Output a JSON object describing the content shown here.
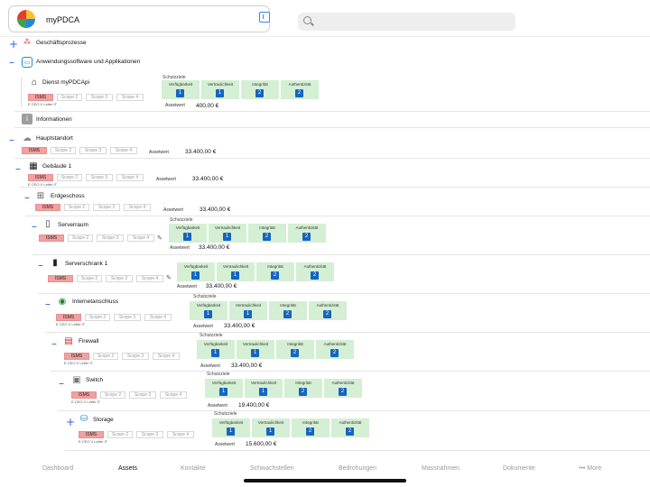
{
  "app": {
    "title": "myPDCA"
  },
  "search": {
    "placeholder": ""
  },
  "labels": {
    "schutzziele": "Schutzziele",
    "verfuegbarkeit": "Verfügbarkeit",
    "vertraulichkeit": "Vertraulichkeit",
    "integritaet": "Integrität",
    "authentizitaet": "Authentizität",
    "assetwert": "Assetwert"
  },
  "top_items": [
    {
      "name": "Geschäftsprozesse"
    },
    {
      "name": "Anwendungssoftware und Applikationen"
    },
    {
      "name": "Informationen"
    }
  ],
  "assets": [
    {
      "name": "Dienst myPDCApi",
      "tags": [
        "ISMS",
        "Scope 2",
        "Scope 3",
        "Scope 4"
      ],
      "owner": "E CEO V Leiter IT",
      "schutzziele": [
        1,
        1,
        2,
        2
      ],
      "assetwert": "400,00 €"
    },
    {
      "name": "Hauptstandort",
      "tags": [
        "ISMS",
        "Scope 2",
        "Scope 3",
        "Scope 4"
      ],
      "owner": "",
      "schutzziele": null,
      "assetwert": "33.400,00 €"
    },
    {
      "name": "Gebäude 1",
      "tags": [
        "ISMS",
        "Scope 2",
        "Scope 3",
        "Scope 4"
      ],
      "owner": "E CEO V Leiter IT",
      "schutzziele": null,
      "assetwert": "33.400,00 €"
    },
    {
      "name": "Erdgeschoss",
      "tags": [
        "ISMS",
        "Scope 2",
        "Scope 3",
        "Scope 4"
      ],
      "owner": "",
      "schutzziele": null,
      "assetwert": "33.400,00 €"
    },
    {
      "name": "Serverraum",
      "tags": [
        "ISMS",
        "Scope 2",
        "Scope 3",
        "Scope 4"
      ],
      "owner": "",
      "schutzziele": [
        1,
        1,
        2,
        2
      ],
      "assetwert": "33.400,00 €"
    },
    {
      "name": "Serverschrank 1",
      "tags": [
        "ISMS",
        "Scope 2",
        "Scope 3",
        "Scope 4"
      ],
      "owner": "",
      "schutzziele": [
        1,
        1,
        2,
        2
      ],
      "assetwert": "33.400,00 €"
    },
    {
      "name": "Internetanschluss",
      "tags": [
        "ISMS",
        "Scope 2",
        "Scope 3",
        "Scope 4"
      ],
      "owner": "E CEO V Leiter IT",
      "schutzziele": [
        1,
        1,
        2,
        2
      ],
      "assetwert": "33.400,00 €"
    },
    {
      "name": "Firewall",
      "tags": [
        "ISMS",
        "Scope 2",
        "Scope 3",
        "Scope 4"
      ],
      "owner": "E CEO V Leiter IT",
      "schutzziele": [
        1,
        1,
        2,
        2
      ],
      "assetwert": "33.400,00 €"
    },
    {
      "name": "Switch",
      "tags": [
        "ISMS",
        "Scope 2",
        "Scope 3",
        "Scope 4"
      ],
      "owner": "E CEO V Leiter IT",
      "schutzziele": [
        1,
        1,
        2,
        2
      ],
      "assetwert": "19.400,00 €"
    },
    {
      "name": "Storage",
      "tags": [
        "ISMS",
        "Scope 2",
        "Scope 3",
        "Scope 4"
      ],
      "owner": "E CEO V Leiter IT",
      "schutzziele": [
        1,
        1,
        2,
        2
      ],
      "assetwert": "15.600,00 €"
    }
  ],
  "tabs": [
    "Dashboard",
    "Assets",
    "Kontakte",
    "Schwachstellen",
    "Bedrohungen",
    "Massnahmen",
    "Dokumente",
    "••• More"
  ],
  "active_tab": "Assets",
  "colors": {
    "accent": "#2563eb",
    "isms_tag": "#f2a0a0",
    "schutzziel_cell": "#d4efd4",
    "level_badge": "#1565c0"
  }
}
